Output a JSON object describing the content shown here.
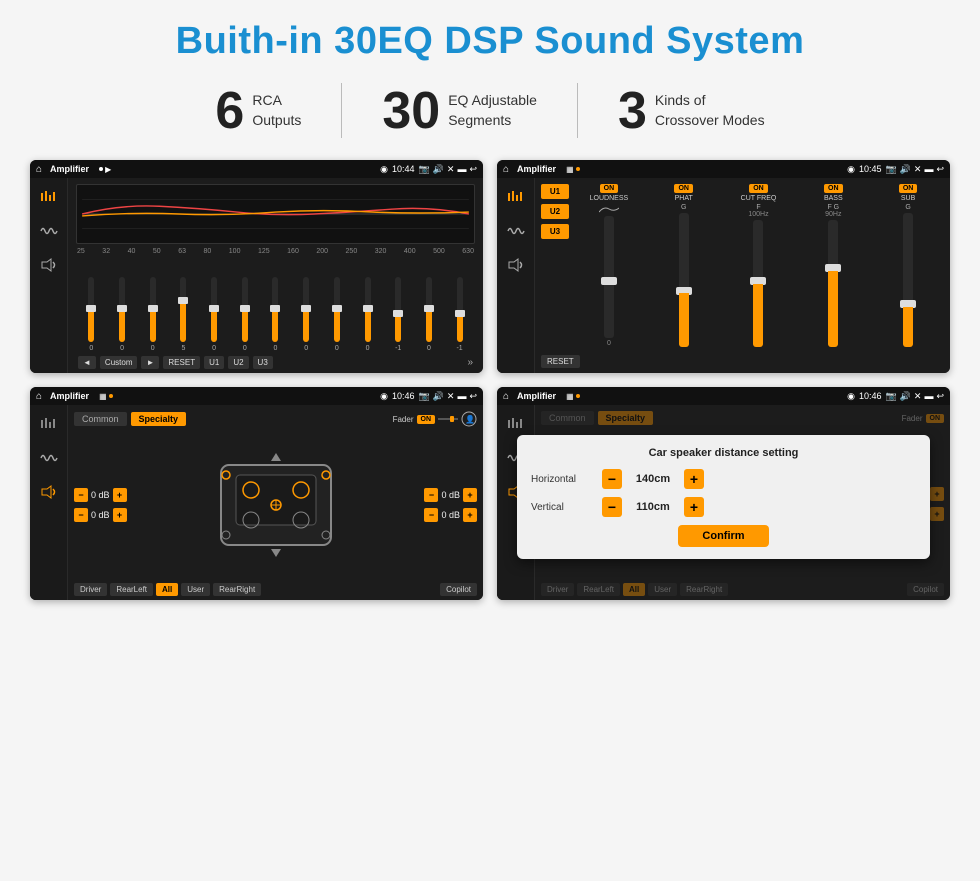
{
  "title": "Buith-in 30EQ DSP Sound System",
  "stats": [
    {
      "number": "6",
      "desc_line1": "RCA",
      "desc_line2": "Outputs"
    },
    {
      "number": "30",
      "desc_line1": "EQ Adjustable",
      "desc_line2": "Segments"
    },
    {
      "number": "3",
      "desc_line1": "Kinds of",
      "desc_line2": "Crossover Modes"
    }
  ],
  "screen1": {
    "appName": "Amplifier",
    "time": "10:44",
    "freq_labels": [
      "25",
      "32",
      "40",
      "50",
      "63",
      "80",
      "100",
      "125",
      "160",
      "200",
      "250",
      "320",
      "400",
      "500",
      "630"
    ],
    "slider_values": [
      "0",
      "0",
      "0",
      "5",
      "0",
      "0",
      "0",
      "0",
      "0",
      "0",
      "-1",
      "0",
      "-1"
    ],
    "buttons": [
      "◄",
      "Custom",
      "►",
      "RESET",
      "U1",
      "U2",
      "U3"
    ]
  },
  "screen2": {
    "appName": "Amplifier",
    "time": "10:45",
    "presets": [
      "U1",
      "U2",
      "U3"
    ],
    "channels": [
      {
        "label": "LOUDNESS",
        "on": true
      },
      {
        "label": "PHAT",
        "on": true
      },
      {
        "label": "CUT FREQ",
        "on": true
      },
      {
        "label": "BASS",
        "on": true
      },
      {
        "label": "SUB",
        "on": true
      }
    ],
    "reset_label": "RESET"
  },
  "screen3": {
    "appName": "Amplifier",
    "time": "10:46",
    "tabs": [
      "Common",
      "Specialty"
    ],
    "active_tab": "Specialty",
    "fader_label": "Fader",
    "fader_on": "ON",
    "vol_items": [
      {
        "val": "0 dB"
      },
      {
        "val": "0 dB"
      },
      {
        "val": "0 dB"
      },
      {
        "val": "0 dB"
      }
    ],
    "footer_btns": [
      "Driver",
      "RearLeft",
      "All",
      "User",
      "RearRight",
      "Copilot"
    ]
  },
  "screen4": {
    "appName": "Amplifier",
    "time": "10:46",
    "tabs": [
      "Common",
      "Specialty"
    ],
    "active_tab": "Specialty",
    "dialog": {
      "title": "Car speaker distance setting",
      "rows": [
        {
          "label": "Horizontal",
          "value": "140cm"
        },
        {
          "label": "Vertical",
          "value": "110cm"
        }
      ],
      "confirm_label": "Confirm"
    },
    "footer_btns": [
      "Driver",
      "RearLeft",
      "All",
      "User",
      "RearRight",
      "Copilot"
    ]
  }
}
